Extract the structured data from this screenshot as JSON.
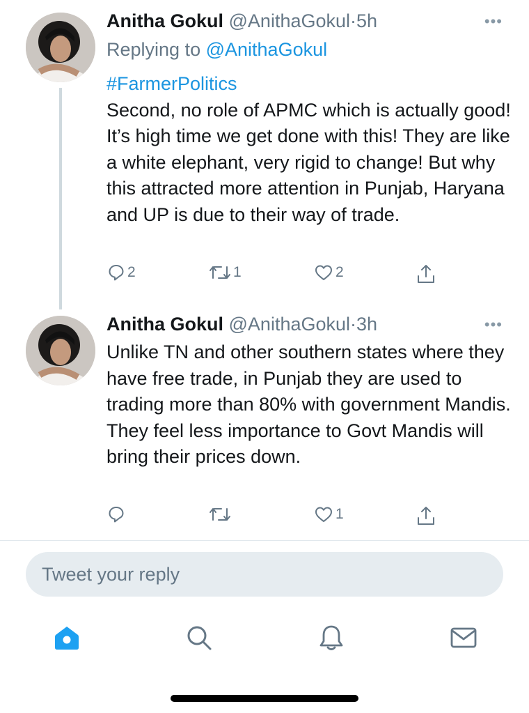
{
  "tweets": [
    {
      "name": "Anitha Gokul",
      "handle": "@AnithaGokul",
      "separator": "·",
      "time": "5h",
      "replying_prefix": "Replying to",
      "replying_to": "@AnithaGokul",
      "hashtag": "#FarmerPolitics",
      "text": "Second, no role of APMC which is actually good! It’s high time we get done with this! They are like a white elephant, very rigid to change! But why this attracted more attention in Punjab, Haryana and UP is due to their way of trade.",
      "replies": "2",
      "retweets": "1",
      "likes": "2",
      "more": "•••"
    },
    {
      "name": "Anitha Gokul",
      "handle": "@AnithaGokul",
      "separator": "·",
      "time": "3h",
      "text": "Unlike TN and other southern states where they have free trade, in Punjab they are used to trading more than 80% with government Mandis. They feel less importance to Govt Mandis will bring their prices down.",
      "replies": "",
      "retweets": "",
      "likes": "1",
      "more": "•••"
    }
  ],
  "reply_box": {
    "placeholder": "Tweet your reply"
  },
  "tabbar": {
    "items": [
      {
        "icon": "home-icon",
        "active": true
      },
      {
        "icon": "search-icon",
        "active": false
      },
      {
        "icon": "notifications-icon",
        "active": false
      },
      {
        "icon": "messages-icon",
        "active": false
      }
    ]
  },
  "colors": {
    "accent": "#1da1f2",
    "link": "#1b95e0",
    "secondary_text": "#657786"
  }
}
